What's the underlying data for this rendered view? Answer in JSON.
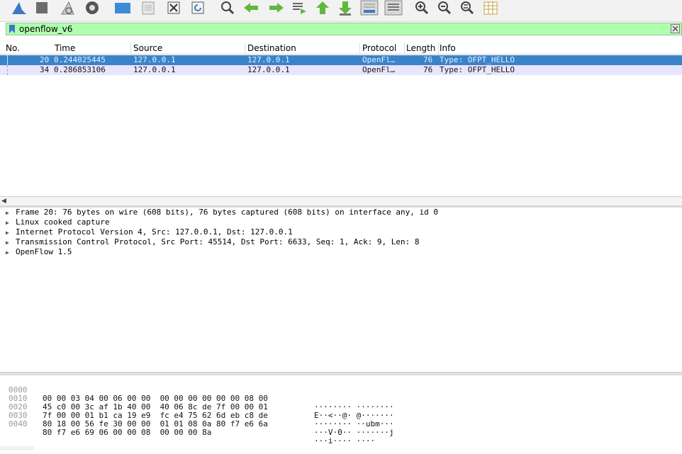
{
  "toolbar": {
    "buttons": [
      {
        "name": "shark-fin-start-icon"
      },
      {
        "name": "stop-capture-icon"
      },
      {
        "name": "restart-capture-icon"
      },
      {
        "name": "capture-options-icon"
      },
      {
        "name": "open-file-icon"
      },
      {
        "name": "save-file-icon"
      },
      {
        "name": "close-file-icon"
      },
      {
        "name": "reload-file-icon"
      },
      {
        "name": "find-packet-icon"
      },
      {
        "name": "go-back-icon"
      },
      {
        "name": "go-forward-icon"
      },
      {
        "name": "go-to-packet-icon"
      },
      {
        "name": "go-first-icon"
      },
      {
        "name": "go-last-icon"
      },
      {
        "name": "auto-scroll-icon"
      },
      {
        "name": "colorize-icon"
      },
      {
        "name": "zoom-in-icon"
      },
      {
        "name": "zoom-out-icon"
      },
      {
        "name": "normal-size-icon"
      },
      {
        "name": "resize-columns-icon"
      }
    ]
  },
  "filter": {
    "value": "openflow_v6"
  },
  "packet_list": {
    "columns": [
      "No.",
      "Time",
      "Source",
      "Destination",
      "Protocol",
      "Length",
      "Info"
    ],
    "rows": [
      {
        "no": "20",
        "time": "0.244025445",
        "source": "127.0.0.1",
        "destination": "127.0.0.1",
        "protocol": "OpenFl…",
        "length": "76",
        "info": "Type: OFPT_HELLO",
        "selected": true
      },
      {
        "no": "34",
        "time": "0.286853106",
        "source": "127.0.0.1",
        "destination": "127.0.0.1",
        "protocol": "OpenFl…",
        "length": "76",
        "info": "Type: OFPT_HELLO",
        "selected": false
      }
    ]
  },
  "details": {
    "lines": [
      "Frame 20: 76 bytes on wire (608 bits), 76 bytes captured (608 bits) on interface any, id 0",
      "Linux cooked capture",
      "Internet Protocol Version 4, Src: 127.0.0.1, Dst: 127.0.0.1",
      "Transmission Control Protocol, Src Port: 45514, Dst Port: 6633, Seq: 1, Ack: 9, Len: 8",
      "OpenFlow 1.5"
    ]
  },
  "bytes": {
    "lines": [
      {
        "offset": "0000",
        "hex": "00 00 03 04 00 06 00 00  00 00 00 00 00 00 08 00",
        "ascii": "········ ········"
      },
      {
        "offset": "0010",
        "hex": "45 c0 00 3c af 1b 40 00  40 06 8c de 7f 00 00 01",
        "ascii": "E··<··@· @·······"
      },
      {
        "offset": "0020",
        "hex": "7f 00 00 01 b1 ca 19 e9  fc e4 75 62 6d eb c8 de",
        "ascii": "········ ··ubm···"
      },
      {
        "offset": "0030",
        "hex": "80 18 00 56 fe 30 00 00  01 01 08 0a 80 f7 e6 6a",
        "ascii": "···V·0·· ·······j"
      },
      {
        "offset": "0040",
        "hex": "80 f7 e6 69 06 00 00 08  00 00 00 8a",
        "ascii": "···i···· ····"
      }
    ]
  },
  "colors": {
    "filter_bg": "#afffaf",
    "selected_row": "#3a83c8",
    "alt_row": "#e7e6ff"
  }
}
